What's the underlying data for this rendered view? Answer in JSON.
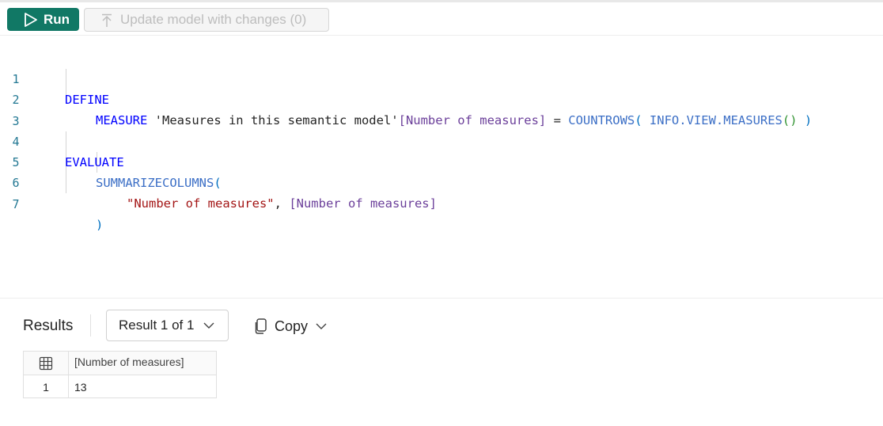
{
  "toolbar": {
    "run_label": "Run",
    "update_label": "Update model with changes (0)"
  },
  "editor": {
    "line_numbers": [
      "1",
      "2",
      "3",
      "4",
      "5",
      "6",
      "7"
    ],
    "line1": {
      "kw": "DEFINE"
    },
    "line2": {
      "kw": "MEASURE",
      "table": " 'Measures in this semantic model'",
      "measure": "[Number of measures]",
      "eq": " = ",
      "fn": "COUNTROWS",
      "open": "( ",
      "fn2": "INFO.VIEW.MEASURES",
      "inner": "()",
      "close": " )"
    },
    "line4": {
      "kw": "EVALUATE"
    },
    "line5": {
      "fn": "SUMMARIZECOLUMNS",
      "open": "("
    },
    "line6": {
      "str": "\"Number of measures\"",
      "comma": ", ",
      "measure": "[Number of measures]"
    },
    "line7": {
      "close": ")"
    }
  },
  "results": {
    "label": "Results",
    "result_selector": "Result 1 of 1",
    "copy_label": "Copy",
    "columns": [
      "[Number of measures]"
    ],
    "rows": [
      {
        "index": "1",
        "values": [
          "13"
        ]
      }
    ]
  },
  "colors": {
    "run_button": "#117865",
    "keyword": "#0000ff",
    "function": "#3c6fc6",
    "string": "#a31515",
    "column": "#6b3f9a"
  }
}
